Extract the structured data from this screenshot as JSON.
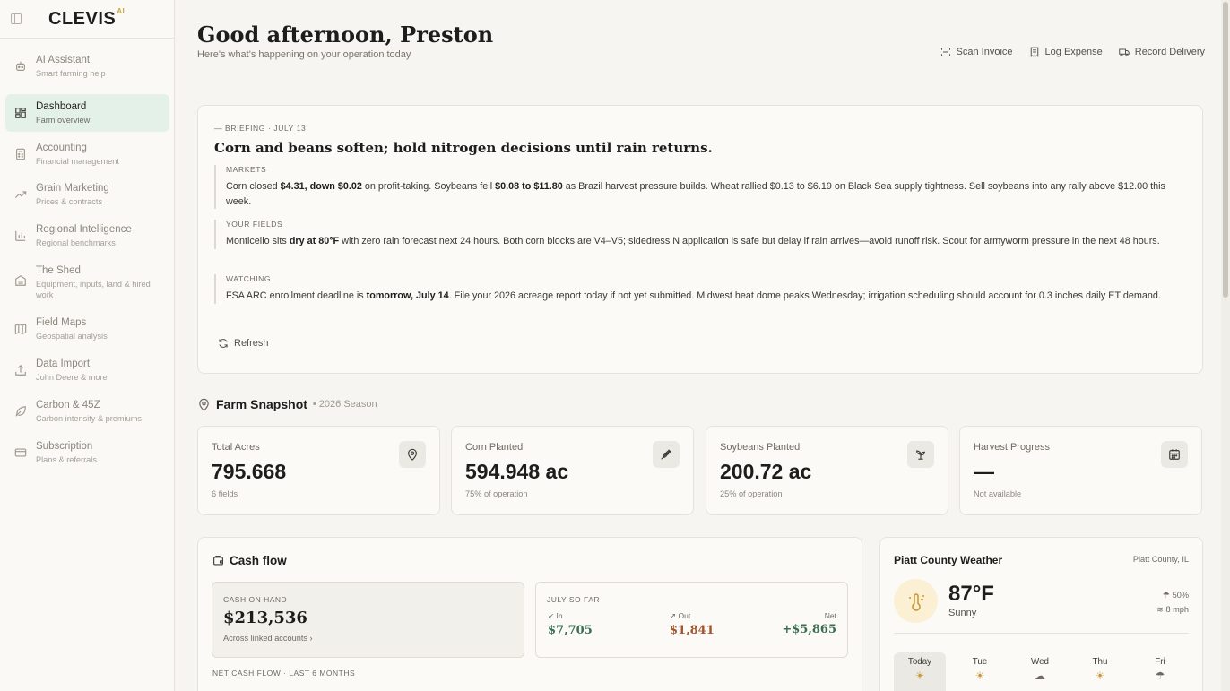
{
  "app": {
    "logo": "CLEVIS",
    "logo_badge": "AI"
  },
  "sidebar": {
    "items": [
      {
        "title": "AI Assistant",
        "sub": "Smart farming help",
        "icon": "bot-icon"
      },
      {
        "title": "Dashboard",
        "sub": "Farm overview",
        "icon": "dashboard-icon"
      },
      {
        "title": "Accounting",
        "sub": "Financial management",
        "icon": "calculator-icon"
      },
      {
        "title": "Grain Marketing",
        "sub": "Prices & contracts",
        "icon": "trend-icon"
      },
      {
        "title": "Regional Intelligence",
        "sub": "Regional benchmarks",
        "icon": "bar-chart-icon"
      },
      {
        "title": "The Shed",
        "sub": "Equipment, inputs, land & hired work",
        "icon": "warehouse-icon"
      },
      {
        "title": "Field Maps",
        "sub": "Geospatial analysis",
        "icon": "map-icon"
      },
      {
        "title": "Data Import",
        "sub": "John Deere & more",
        "icon": "upload-icon"
      },
      {
        "title": "Carbon & 45Z",
        "sub": "Carbon intensity & premiums",
        "icon": "leaf-icon"
      },
      {
        "title": "Subscription",
        "sub": "Plans & referrals",
        "icon": "card-icon"
      }
    ]
  },
  "header": {
    "greeting": "Good afternoon, Preston",
    "subtitle": "Here's what's happening on your operation today",
    "actions": [
      "Scan Invoice",
      "Log Expense",
      "Record Delivery"
    ]
  },
  "briefing": {
    "tag": "— BRIEFING · JULY 13",
    "title": "Corn and beans soften; hold nitrogen decisions until rain returns.",
    "markets": {
      "label": "MARKETS",
      "t1": "Corn closed ",
      "b1": "$4.31, down $0.02",
      "t2": " on profit-taking. Soybeans fell ",
      "b2": "$0.08 to $11.80",
      "t3": " as Brazil harvest pressure builds. Wheat rallied $0.13 to $6.19 on Black Sea supply tightness. Sell soybeans into any rally above $12.00 this week."
    },
    "fields": {
      "label": "YOUR FIELDS",
      "t1": "Monticello sits ",
      "b1": "dry at 80°F",
      "t2": " with zero rain forecast next 24 hours. Both corn blocks are V4–V5; sidedress N application is safe but delay if rain arrives—avoid runoff risk. Scout for armyworm pressure in the next 48 hours."
    },
    "watching": {
      "label": "WATCHING",
      "t1": "FSA ARC enrollment deadline is ",
      "b1": "tomorrow, July 14",
      "t2": ". File your 2026 acreage report today if not yet submitted. Midwest heat dome peaks Wednesday; irrigation scheduling should account for 0.3 inches daily ET demand."
    },
    "refresh": "Refresh"
  },
  "snapshot": {
    "title": "Farm Snapshot",
    "season": "• 2026 Season",
    "cards": [
      {
        "label": "Total Acres",
        "value": "795.668",
        "sub": "6 fields",
        "icon": "location-pin-icon"
      },
      {
        "label": "Corn Planted",
        "value": "594.948 ac",
        "sub": "75% of operation",
        "icon": "wheat-icon"
      },
      {
        "label": "Soybeans Planted",
        "value": "200.72 ac",
        "sub": "25% of operation",
        "icon": "sprout-icon"
      },
      {
        "label": "Harvest Progress",
        "value": "—",
        "sub": "Not available",
        "icon": "calendar-icon"
      }
    ]
  },
  "cashflow": {
    "title": "Cash flow",
    "cash_on_hand_label": "CASH ON HAND",
    "cash_on_hand": "$213,536",
    "linked": "Across linked accounts",
    "july_label": "JULY SO FAR",
    "in_label": "In",
    "in_value": "$7,705",
    "out_label": "Out",
    "out_value": "$1,841",
    "net_label": "Net",
    "net_value": "+$5,865",
    "ncf_label": "NET CASH FLOW · LAST 6 MONTHS",
    "colors": {
      "in": "#3a6e4f",
      "out": "#a0552f",
      "net": "#3a6e4f"
    }
  },
  "weather": {
    "title": "Piatt County Weather",
    "location": "Piatt County, IL",
    "temp": "87°F",
    "condition": "Sunny",
    "precip": "50%",
    "wind": "8 mph",
    "days": [
      {
        "name": "Today",
        "icon": "sun-icon"
      },
      {
        "name": "Tue",
        "icon": "sun-icon"
      },
      {
        "name": "Wed",
        "icon": "cloud-icon"
      },
      {
        "name": "Thu",
        "icon": "sun-icon"
      },
      {
        "name": "Fri",
        "icon": "rain-icon"
      }
    ]
  }
}
